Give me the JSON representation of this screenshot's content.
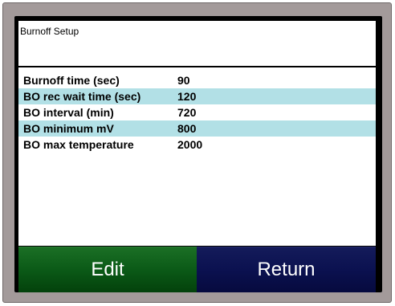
{
  "screen": {
    "title": "Burnoff Setup"
  },
  "settings": [
    {
      "label": "Burnoff time (sec)",
      "value": "90"
    },
    {
      "label": "BO rec wait time (sec)",
      "value": "120"
    },
    {
      "label": "BO interval (min)",
      "value": "720"
    },
    {
      "label": "BO minimum mV",
      "value": "800"
    },
    {
      "label": "BO max temperature",
      "value": "2000"
    }
  ],
  "buttons": {
    "edit_label": "Edit",
    "return_label": "Return"
  },
  "colors": {
    "row_highlight": "#b2e0e6",
    "edit_button": "#0b5a17",
    "return_button": "#0b1150"
  }
}
